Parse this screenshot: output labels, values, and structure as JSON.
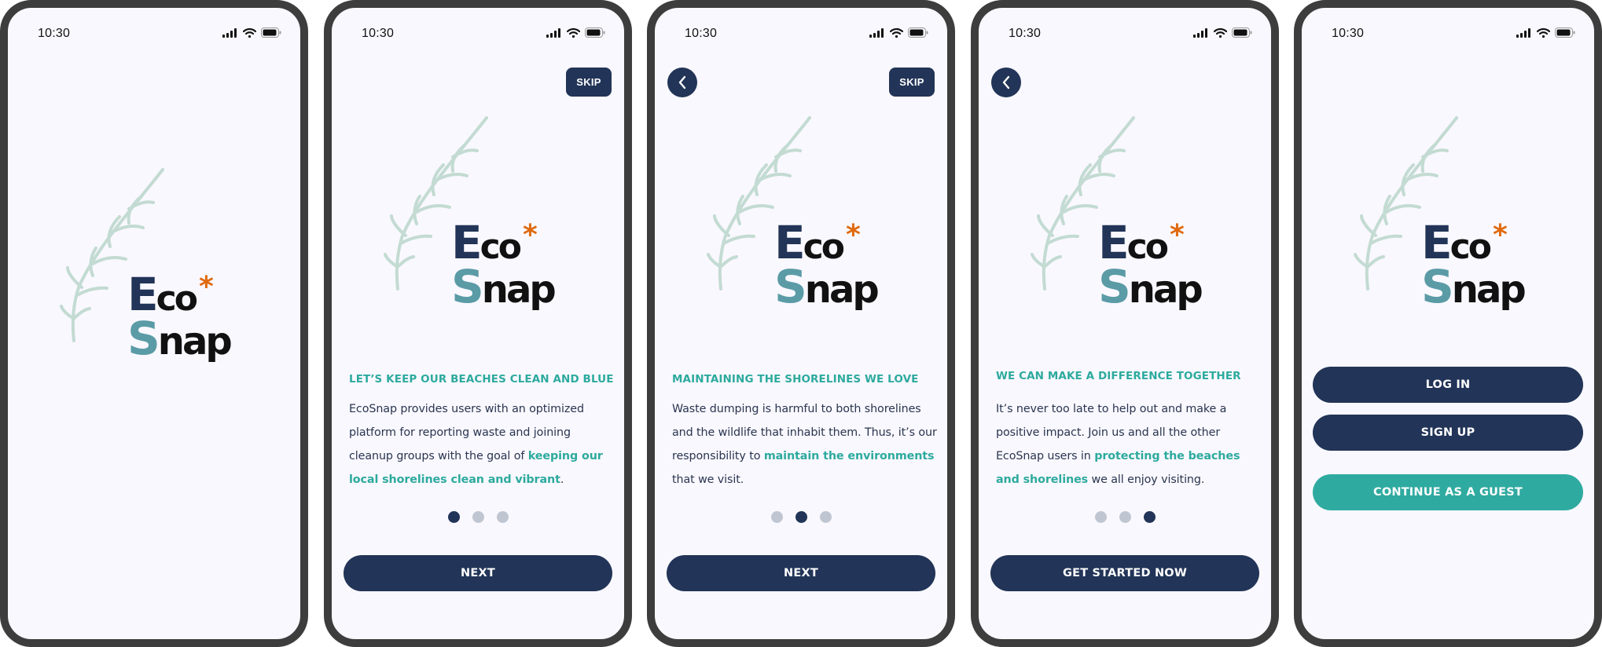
{
  "colors": {
    "navy": "#223457",
    "teal": "#2daa9e",
    "snap_teal": "#5a9ba6",
    "accent_orange": "#e06a0e",
    "leaf": "#c3dbd2",
    "inactive_dot": "#c0c6d1",
    "frame": "#3d3d3d",
    "screen_bg": "#f9f8fe"
  },
  "status_bar": {
    "time": "10:30",
    "icons": [
      "cellular-signal-icon",
      "wifi-icon",
      "battery-icon"
    ]
  },
  "logo": {
    "line1_first": "E",
    "line1_rest": "co",
    "asterisk": "*",
    "line2_first": "S",
    "line2_rest": "nap"
  },
  "screens": [
    {
      "name": "splash"
    },
    {
      "name": "onboarding-1",
      "skip_label": "SKIP",
      "heading": "LET’S KEEP OUR BEACHES CLEAN AND BLUE",
      "body_parts": [
        {
          "text": "EcoSnap provides users with an optimized platform for reporting waste and joining cleanup groups with the goal of ",
          "highlight": false
        },
        {
          "text": "keeping our local shorelines clean and vibrant",
          "highlight": true
        },
        {
          "text": ".",
          "highlight": false
        }
      ],
      "page_index": 1,
      "page_count": 3,
      "primary_button": "NEXT"
    },
    {
      "name": "onboarding-2",
      "skip_label": "SKIP",
      "heading": "MAINTAINING THE SHORELINES WE LOVE",
      "body_parts": [
        {
          "text": "Waste dumping is harmful to both shorelines and the wildlife that inhabit them. Thus, it’s our responsibility to ",
          "highlight": false
        },
        {
          "text": "maintain the environments",
          "highlight": true
        },
        {
          "text": " that we visit.",
          "highlight": false
        }
      ],
      "page_index": 2,
      "page_count": 3,
      "primary_button": "NEXT"
    },
    {
      "name": "onboarding-3",
      "heading": "WE CAN MAKE A DIFFERENCE TOGETHER",
      "body_parts": [
        {
          "text": "It’s never too late to help out and make a positive impact. Join us and all the other EcoSnap users in ",
          "highlight": false
        },
        {
          "text": "protecting the beaches and shorelines",
          "highlight": true
        },
        {
          "text": " we all enjoy visiting.",
          "highlight": false
        }
      ],
      "page_index": 3,
      "page_count": 3,
      "primary_button": "GET STARTED NOW"
    },
    {
      "name": "auth-choice",
      "login_label": "LOG IN",
      "signup_label": "SIGN UP",
      "guest_label": "CONTINUE AS A GUEST"
    }
  ]
}
